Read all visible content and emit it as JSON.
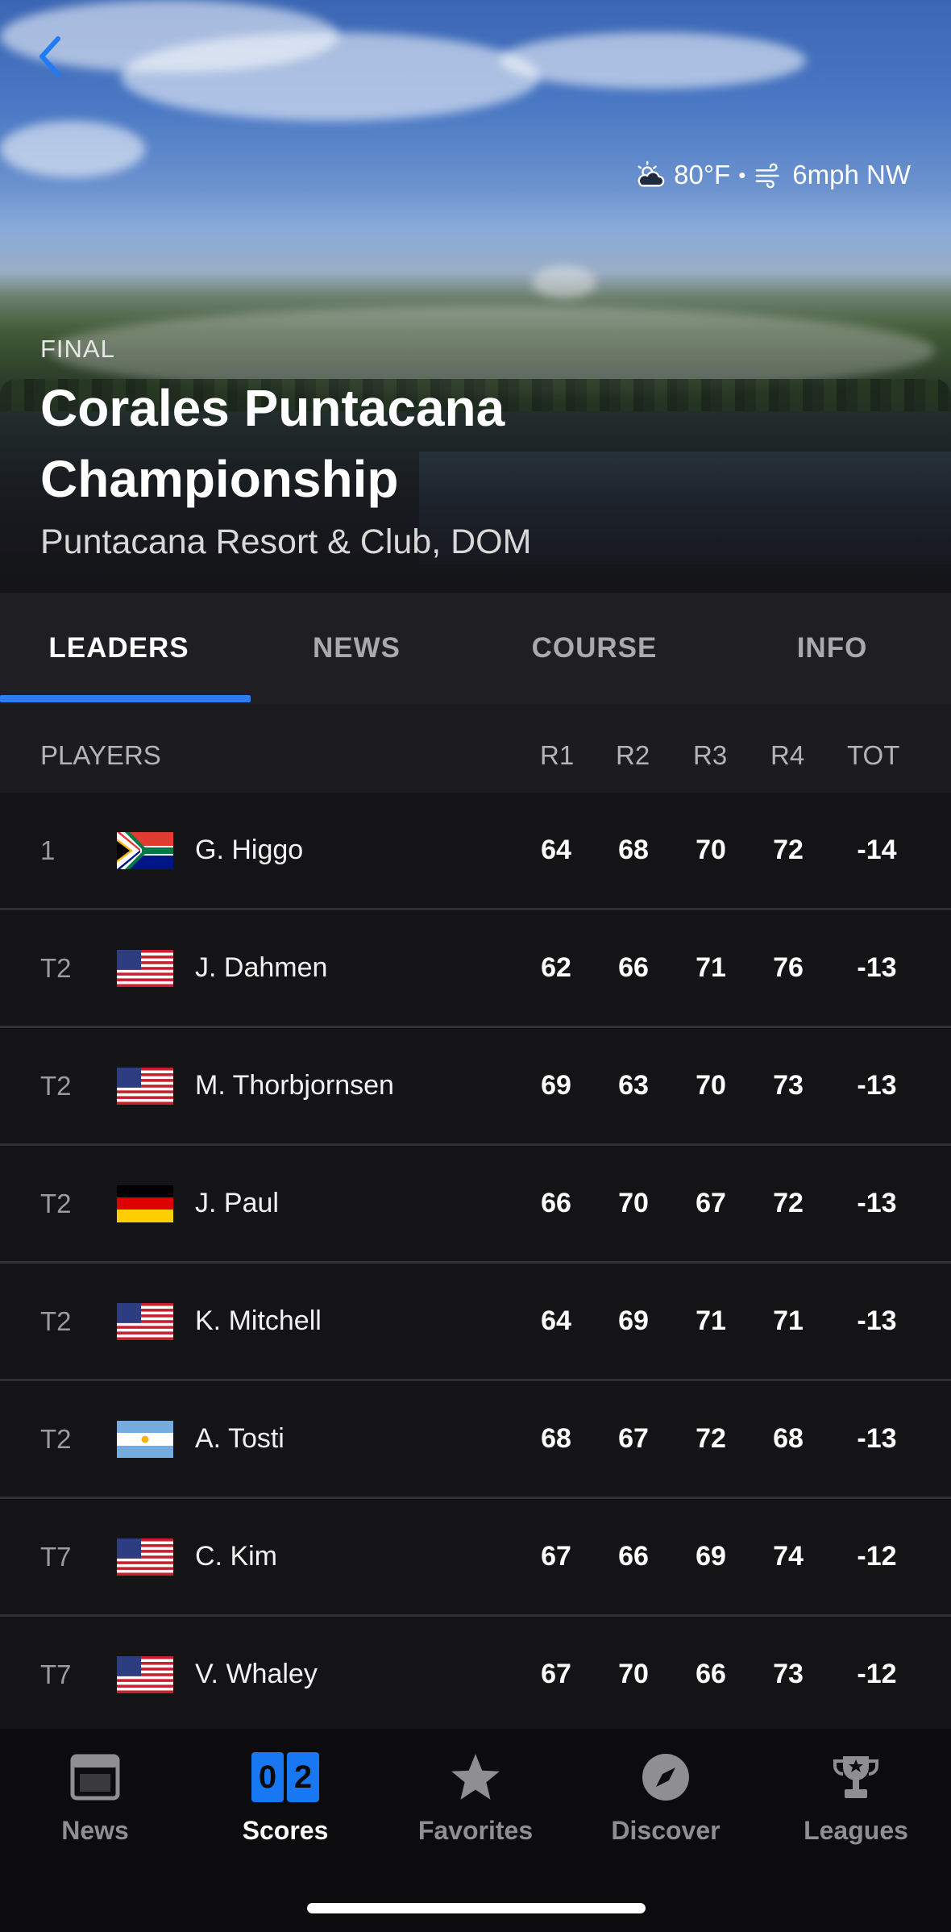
{
  "weather": {
    "temperature": "80°F",
    "separator": "•",
    "wind": "6mph NW"
  },
  "event": {
    "status": "FINAL",
    "title": "Corales Puntacana Championship",
    "venue": "Puntacana Resort & Club, DOM"
  },
  "tabs": [
    {
      "label": "LEADERS",
      "active": true
    },
    {
      "label": "NEWS",
      "active": false
    },
    {
      "label": "COURSE",
      "active": false
    },
    {
      "label": "INFO",
      "active": false
    }
  ],
  "table": {
    "headers": {
      "players": "PLAYERS",
      "r1": "R1",
      "r2": "R2",
      "r3": "R3",
      "r4": "R4",
      "tot": "TOT"
    },
    "rows": [
      {
        "pos": "1",
        "flag": "south-africa-flag-icon",
        "name": "G. Higgo",
        "r1": "64",
        "r2": "68",
        "r3": "70",
        "r4": "72",
        "tot": "-14"
      },
      {
        "pos": "T2",
        "flag": "usa-flag-icon",
        "name": "J. Dahmen",
        "r1": "62",
        "r2": "66",
        "r3": "71",
        "r4": "76",
        "tot": "-13"
      },
      {
        "pos": "T2",
        "flag": "usa-flag-icon",
        "name": "M. Thorbjornsen",
        "r1": "69",
        "r2": "63",
        "r3": "70",
        "r4": "73",
        "tot": "-13"
      },
      {
        "pos": "T2",
        "flag": "germany-flag-icon",
        "name": "J. Paul",
        "r1": "66",
        "r2": "70",
        "r3": "67",
        "r4": "72",
        "tot": "-13"
      },
      {
        "pos": "T2",
        "flag": "usa-flag-icon",
        "name": "K. Mitchell",
        "r1": "64",
        "r2": "69",
        "r3": "71",
        "r4": "71",
        "tot": "-13"
      },
      {
        "pos": "T2",
        "flag": "argentina-flag-icon",
        "name": "A. Tosti",
        "r1": "68",
        "r2": "67",
        "r3": "72",
        "r4": "68",
        "tot": "-13"
      },
      {
        "pos": "T7",
        "flag": "usa-flag-icon",
        "name": "C. Kim",
        "r1": "67",
        "r2": "66",
        "r3": "69",
        "r4": "74",
        "tot": "-12"
      },
      {
        "pos": "T7",
        "flag": "usa-flag-icon",
        "name": "V. Whaley",
        "r1": "67",
        "r2": "70",
        "r3": "66",
        "r4": "73",
        "tot": "-12"
      }
    ]
  },
  "nav": [
    {
      "label": "News",
      "icon": "news-icon",
      "active": false
    },
    {
      "label": "Scores",
      "icon": "scores-icon",
      "active": true,
      "digits": [
        "0",
        "2"
      ]
    },
    {
      "label": "Favorites",
      "icon": "star-icon",
      "active": false
    },
    {
      "label": "Discover",
      "icon": "compass-icon",
      "active": false
    },
    {
      "label": "Leagues",
      "icon": "trophy-icon",
      "active": false
    }
  ],
  "colors": {
    "accent": "#2e7bf6",
    "background": "#141417",
    "scores_badge": "#1877f2"
  }
}
